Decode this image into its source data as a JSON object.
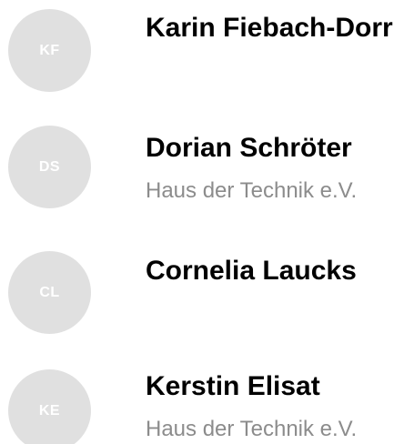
{
  "contacts": [
    {
      "initials": "KF",
      "name": "Karin Fiebach-Dorr",
      "organization": ""
    },
    {
      "initials": "DS",
      "name": "Dorian Schröter",
      "organization": "Haus der Technik e.V."
    },
    {
      "initials": "CL",
      "name": "Cornelia Laucks",
      "organization": ""
    },
    {
      "initials": "KE",
      "name": "Kerstin Elisat",
      "organization": "Haus der Technik e.V."
    }
  ],
  "colors": {
    "avatar_bg": "#e0e0e0",
    "initials": "#ffffff",
    "name": "#000000",
    "organization": "#8c8c8c"
  }
}
